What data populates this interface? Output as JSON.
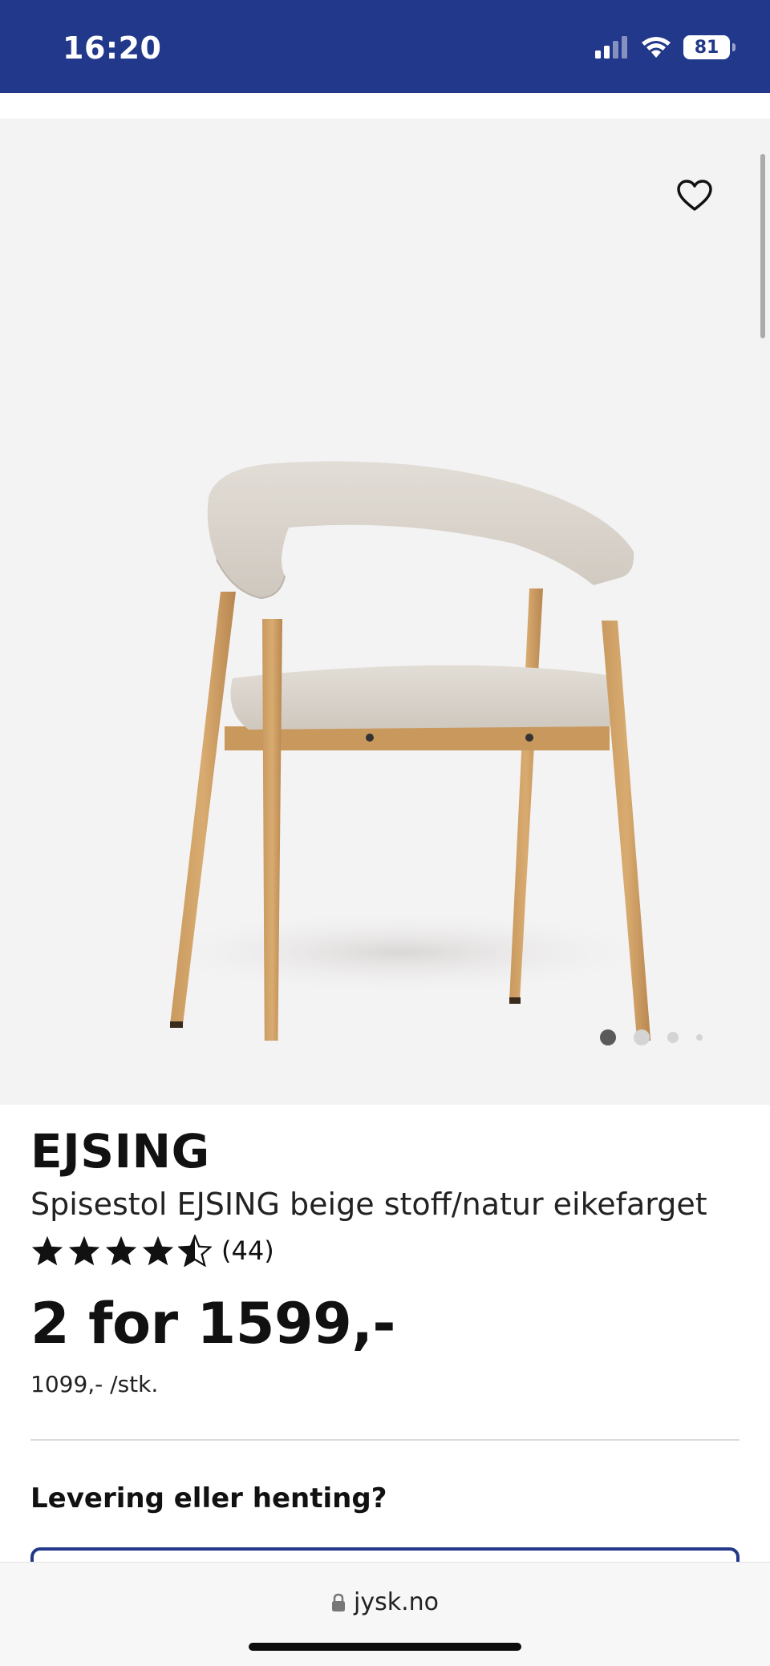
{
  "status_bar": {
    "time": "16:20",
    "battery": "81",
    "background": "#22388a"
  },
  "gallery": {
    "favorite_icon": "heart-outline-icon",
    "image_alt": "beige upholstered dining chair with oak-colored legs",
    "image_count": 4,
    "active_index": 0
  },
  "product": {
    "brand": "EJSING",
    "name": "Spisestol EJSING beige stoff/natur eikefarget",
    "rating": 4.5,
    "rating_max": 5,
    "rating_count": "(44)",
    "price": "2 for 1599,-",
    "unit_price": "1099,- /stk."
  },
  "delivery": {
    "title": "Levering eller henting?"
  },
  "browser": {
    "url": "jysk.no",
    "lock_icon": "lock-icon"
  }
}
